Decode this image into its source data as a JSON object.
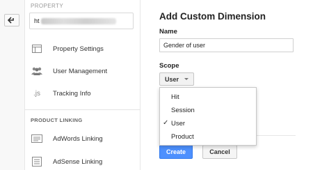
{
  "left_bar": {
    "back_icon": "back-arrow-icon"
  },
  "sidebar": {
    "property_label": "PROPERTY",
    "property_value": "ht",
    "items": [
      {
        "label": "Property Settings",
        "icon": "property-settings-icon"
      },
      {
        "label": "User Management",
        "icon": "users-icon"
      },
      {
        "label": "Tracking Info",
        "icon": "js-icon",
        "icon_text": ".js"
      }
    ],
    "section_label": "PRODUCT LINKING",
    "linking_items": [
      {
        "label": "AdWords Linking",
        "icon": "adwords-icon"
      },
      {
        "label": "AdSense Linking",
        "icon": "adsense-icon"
      }
    ]
  },
  "main": {
    "title": "Add Custom Dimension",
    "name_label": "Name",
    "name_value": "Gender of user",
    "scope_label": "Scope",
    "scope_value": "User",
    "scope_options": [
      "Hit",
      "Session",
      "User",
      "Product"
    ],
    "scope_selected_index": 2,
    "create_label": "Create",
    "cancel_label": "Cancel"
  },
  "colors": {
    "primary_button": "#4d90fe",
    "border": "#c8c8c8"
  }
}
